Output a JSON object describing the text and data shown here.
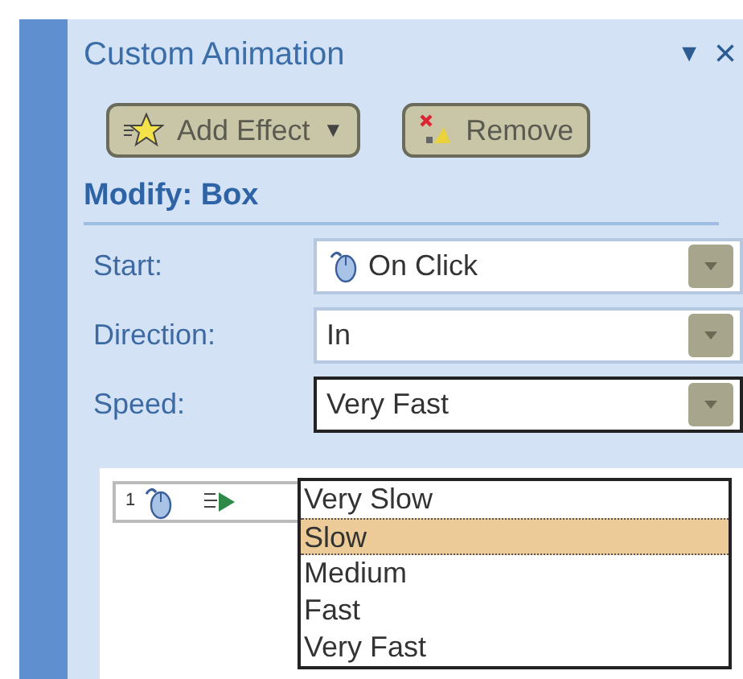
{
  "pane": {
    "title": "Custom Animation",
    "menu_glyph": "▼",
    "close_glyph": "×"
  },
  "buttons": [
    {
      "kind": "add",
      "label": "Add Effect",
      "caret": "▼"
    },
    {
      "kind": "remove",
      "label": "Remove"
    }
  ],
  "section": "Modify: Box",
  "fields": [
    {
      "kind": "trigger",
      "label": "Start:",
      "value": "On Click",
      "expanded": false
    },
    {
      "kind": "plain",
      "label": "Direction:",
      "value": "In",
      "expanded": false
    },
    {
      "kind": "plain",
      "label": "Speed:",
      "value": "Very Fast",
      "expanded": true
    }
  ],
  "dropdown_options": [
    {
      "label": "Very Slow",
      "selected": false
    },
    {
      "label": "Slow",
      "selected": true
    },
    {
      "label": "Medium",
      "selected": false
    },
    {
      "label": "Fast",
      "selected": false
    },
    {
      "label": "Very Fast",
      "selected": false
    }
  ],
  "effect_list": [
    {
      "number": "1"
    }
  ]
}
